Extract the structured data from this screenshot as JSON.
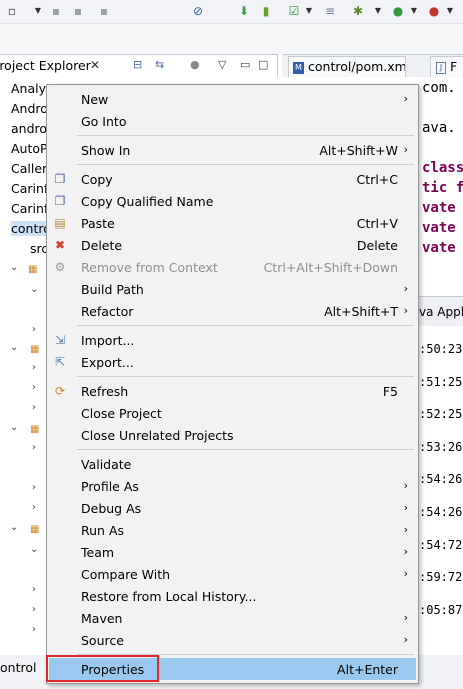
{
  "toolbar": {
    "icons": [
      "new-window-icon",
      "save-icon",
      "save-all-icon",
      "print-icon",
      "skip-breakpoints-icon",
      "download-icon",
      "device-icon",
      "checkbox-icon",
      "compare-icon",
      "debug-icon",
      "run-icon",
      "profile-icon"
    ]
  },
  "explorer": {
    "title": "Project Explorer",
    "close": "✕"
  },
  "editor_tabs": [
    {
      "label": "control/pom.xml",
      "badge": "M"
    },
    {
      "label": "F",
      "badge": "J"
    }
  ],
  "tree": {
    "items": [
      "Analys",
      "Andro",
      "andro",
      "AutoP",
      "Caller",
      "Carinf",
      "Carinf",
      "contro",
      "src"
    ]
  },
  "code": {
    "lines": [
      "com.",
      "",
      "ava.",
      "",
      "class",
      "tic f",
      "vate",
      "vate",
      "vate"
    ]
  },
  "console": {
    "header": "va Appl",
    "lines": [
      ":50:23",
      ":51:25",
      ":52:25",
      ":53:26",
      ":54:26",
      ":54:26",
      ":54:72",
      ":59:72",
      ":05:87"
    ]
  },
  "status": {
    "label": "ontrol"
  },
  "menu": {
    "groups": [
      [
        {
          "label": "New",
          "submenu": true
        },
        {
          "label": "Go Into"
        }
      ],
      [
        {
          "label": "Show In",
          "shortcut": "Alt+Shift+W",
          "submenu": true
        }
      ],
      [
        {
          "label": "Copy",
          "shortcut": "Ctrl+C",
          "icon": "copy-icon"
        },
        {
          "label": "Copy Qualified Name",
          "icon": "copy-qualified-icon"
        },
        {
          "label": "Paste",
          "shortcut": "Ctrl+V",
          "icon": "paste-icon"
        },
        {
          "label": "Delete",
          "shortcut": "Delete",
          "icon": "delete-icon"
        },
        {
          "label": "Remove from Context",
          "shortcut": "Ctrl+Alt+Shift+Down",
          "disabled": true,
          "icon": "remove-context-icon"
        },
        {
          "label": "Build Path",
          "submenu": true
        },
        {
          "label": "Refactor",
          "shortcut": "Alt+Shift+T",
          "submenu": true
        }
      ],
      [
        {
          "label": "Import...",
          "icon": "import-icon"
        },
        {
          "label": "Export...",
          "icon": "export-icon"
        }
      ],
      [
        {
          "label": "Refresh",
          "shortcut": "F5",
          "icon": "refresh-icon"
        },
        {
          "label": "Close Project"
        },
        {
          "label": "Close Unrelated Projects"
        }
      ],
      [
        {
          "label": "Validate"
        },
        {
          "label": "Profile As",
          "submenu": true
        },
        {
          "label": "Debug As",
          "submenu": true
        },
        {
          "label": "Run As",
          "submenu": true
        },
        {
          "label": "Team",
          "submenu": true
        },
        {
          "label": "Compare With",
          "submenu": true
        },
        {
          "label": "Restore from Local History..."
        },
        {
          "label": "Maven",
          "submenu": true
        },
        {
          "label": "Source",
          "submenu": true
        }
      ],
      [
        {
          "label": "Properties",
          "shortcut": "Alt+Enter",
          "highlighted": true
        }
      ]
    ]
  },
  "colors": {
    "menu_bg": "#f2f2f2",
    "highlight": "#99c9ef",
    "annotation": "#e0262a"
  }
}
